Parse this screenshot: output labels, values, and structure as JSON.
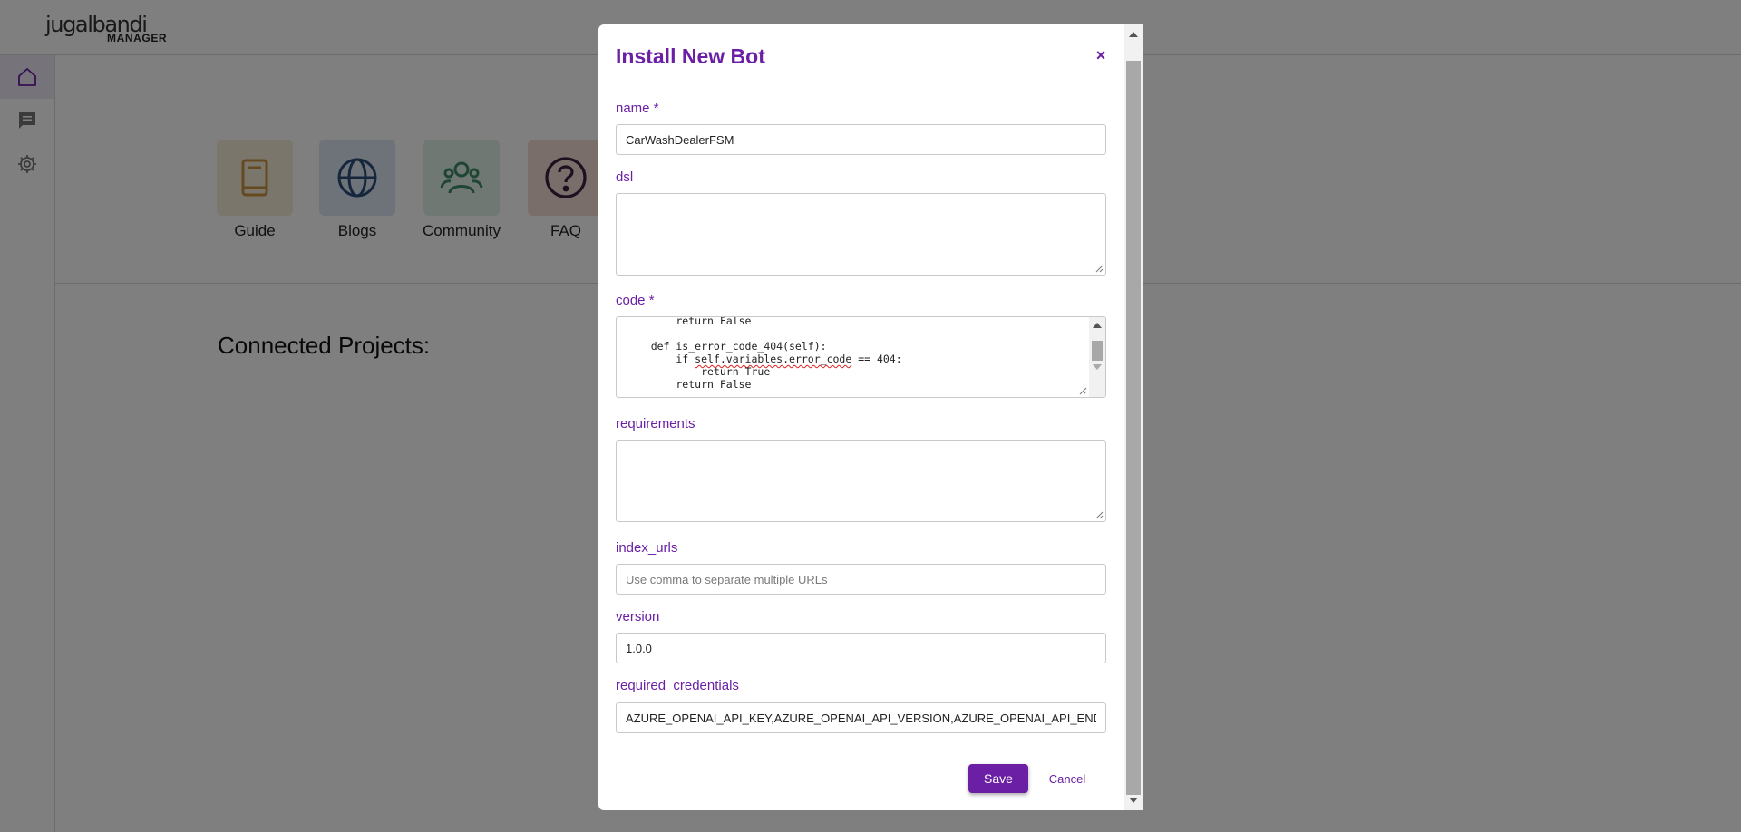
{
  "app": {
    "logo_main": "jugalbandi",
    "logo_sub": "MANAGER"
  },
  "sidebar": {
    "items": [
      {
        "icon": "home-icon",
        "active": true
      },
      {
        "icon": "chat-icon",
        "active": false
      },
      {
        "icon": "gear-icon",
        "active": false
      }
    ]
  },
  "resources": {
    "items": [
      {
        "label": "Guide",
        "icon": "book-icon",
        "color": "#c9953c",
        "tile": "#f7ecd9"
      },
      {
        "label": "Blogs",
        "icon": "globe-icon",
        "color": "#2c4f7a",
        "tile": "#dbe6f2"
      },
      {
        "label": "Community",
        "icon": "people-icon",
        "color": "#3f8d6a",
        "tile": "#e0f0e7"
      },
      {
        "label": "FAQ",
        "icon": "help-icon",
        "color": "#3a2340",
        "tile": "#f2dcd5"
      }
    ]
  },
  "main": {
    "connected_title": "Connected Projects:"
  },
  "modal": {
    "title": "Install New Bot",
    "close_label": "×",
    "fields": {
      "name": {
        "label": "name *",
        "value": "CarWashDealerFSM"
      },
      "dsl": {
        "label": "dsl",
        "value": ""
      },
      "code": {
        "label": "code *",
        "lines": [
          "        return False",
          "",
          "    def is_error_code_404(self):",
          "        if self.variables.error_code == 404:",
          "            return True",
          "        return False"
        ]
      },
      "requirements": {
        "label": "requirements",
        "value": ""
      },
      "index_urls": {
        "label": "index_urls",
        "value": "",
        "placeholder": "Use comma to separate multiple URLs"
      },
      "version": {
        "label": "version",
        "value": "1.0.0"
      },
      "required_credentials": {
        "label": "required_credentials",
        "value": "AZURE_OPENAI_API_KEY,AZURE_OPENAI_API_VERSION,AZURE_OPENAI_API_ENDPOINT"
      }
    },
    "save_label": "Save",
    "cancel_label": "Cancel"
  },
  "colors": {
    "accent": "#6a1fa5",
    "overlay": "rgba(0,0,0,0.5)"
  }
}
